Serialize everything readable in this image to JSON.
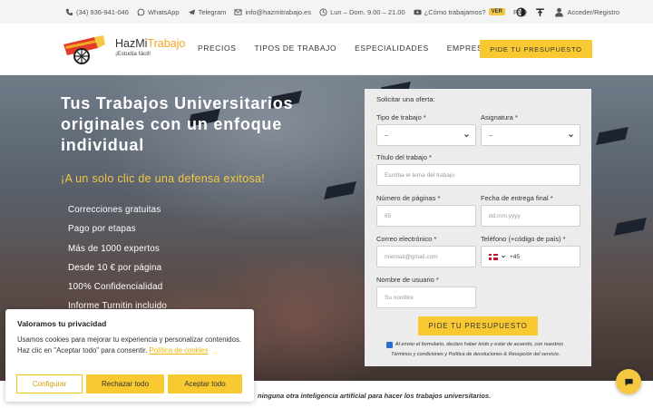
{
  "topbar": {
    "phone": "(34) 936-941-046",
    "whatsapp": "WhatsApp",
    "telegram": "Telegram",
    "email": "info@hazmitrabajo.es",
    "hours": "Lun – Dom. 9.00 – 21.00",
    "how_it_works": "¿Cómo trabajamos?",
    "ver_badge": "VER",
    "faq": "FAQ",
    "login": "Acceder/Registro"
  },
  "header": {
    "logo_name_a": "HazMi",
    "logo_name_b": "Trabajo",
    "logo_tagline": "¡Estudia fácil!",
    "nav": [
      "PRECIOS",
      "TIPOS DE TRABAJO",
      "ESPECIALIDADES",
      "EMPRESA"
    ],
    "cta": "PIDE TU PRESUPUESTO"
  },
  "hero": {
    "title": "Tus Trabajos Universitarios originales con un enfoque individual",
    "subtitle": "¡A un solo clic de una defensa exitosa!",
    "features": [
      "Correcciones gratuitas",
      "Pago por etapas",
      "Más de 1000 expertos",
      "Desde 10 € por página",
      "100% Confidencialidad",
      "Informe Turnitin incluido"
    ]
  },
  "form": {
    "title": "Solicitar una oferta:",
    "work_type_label": "Tipo de trabajo *",
    "work_type_value": "--",
    "subject_label": "Asignatura *",
    "subject_value": "--",
    "work_title_label": "Título del trabajo *",
    "work_title_placeholder": "Escriba el tema del trabajo",
    "pages_label": "Número de páginas *",
    "pages_placeholder": "65",
    "deadline_label": "Fecha de entrega final *",
    "deadline_placeholder": "dd.mm.yyyy",
    "email_label": "Correo electrónico *",
    "email_placeholder": "miemail@gmail.com",
    "phone_label": "Teléfono (+código de país) *",
    "phone_code": "+45",
    "username_label": "Nombre de usuario *",
    "username_placeholder": "Su nombre",
    "submit": "PIDE TU PRESUPUESTO",
    "consent_a": "Al enviar el formulario, declaro haber leído y estar de acuerdo, con nuestros",
    "consent_b": "Términos y condiciones y Política de devoluciones & Recepción del servicio."
  },
  "bottom": {
    "text": "ninguna otra inteligencia artificial para hacer los trabajos universitarios."
  },
  "cookie": {
    "title": "Valoramos tu privacidad",
    "text": "Usamos cookies para mejorar tu experiencia y personalizar contenidos. Haz clic en \"Aceptar todo\" para consentir.",
    "policy_link": "Política de cookies",
    "configure": "Configurar",
    "reject": "Rechazar todo",
    "accept": "Aceptar todo"
  },
  "colors": {
    "accent": "#f9c932",
    "subtitle": "#f5c842",
    "topbar_bg": "#f4f4f4",
    "form_bg": "#ececec"
  },
  "icons": [
    "phone-icon",
    "whatsapp-icon",
    "telegram-icon",
    "email-icon",
    "clock-icon",
    "youtube-icon",
    "contrast-icon",
    "font-size-icon",
    "user-icon",
    "chat-icon",
    "chevron-down-icon"
  ]
}
